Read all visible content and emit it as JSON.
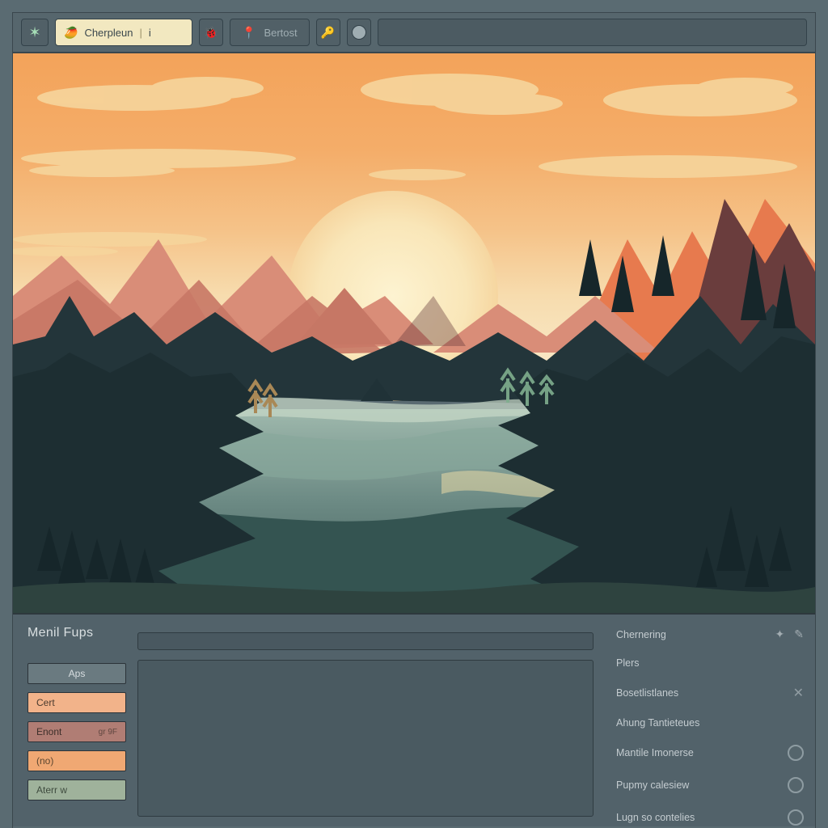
{
  "toolbar": {
    "main_label": "Cherpleun",
    "main_badge": "i",
    "secondary_label": "Bertost"
  },
  "icons": {
    "app": "star-icon",
    "seed": "seed-icon",
    "bug": "bug-icon",
    "pin": "pin-icon",
    "key": "key-icon",
    "dot": "dot-icon",
    "fx": "fx-icon",
    "tool": "tool-icon",
    "close": "close-icon"
  },
  "panel": {
    "title": "Menil Fups",
    "chips": [
      {
        "label": "Aps",
        "style": "grey"
      },
      {
        "label": "Cert",
        "style": "peach"
      },
      {
        "label": "Enont",
        "style": "mauve",
        "tag": "gr 9F"
      },
      {
        "label": "(no)",
        "style": "orange"
      },
      {
        "label": "Aterr w",
        "style": "sage"
      }
    ],
    "right": {
      "heading": "Chernering",
      "items": [
        "Plers",
        "Bosetlistlanes",
        "Ahung Tantieteues",
        "Mantile Imonerse",
        "Pupmy calesiew",
        "Lugn so contelies"
      ]
    }
  },
  "colors": {
    "frame": "#5a6b72",
    "accent_cream": "#f2e8c0",
    "chip_peach": "#f2b38a",
    "chip_mauve": "#b07d74",
    "chip_orange": "#f0a873",
    "chip_sage": "#9fb29b"
  }
}
